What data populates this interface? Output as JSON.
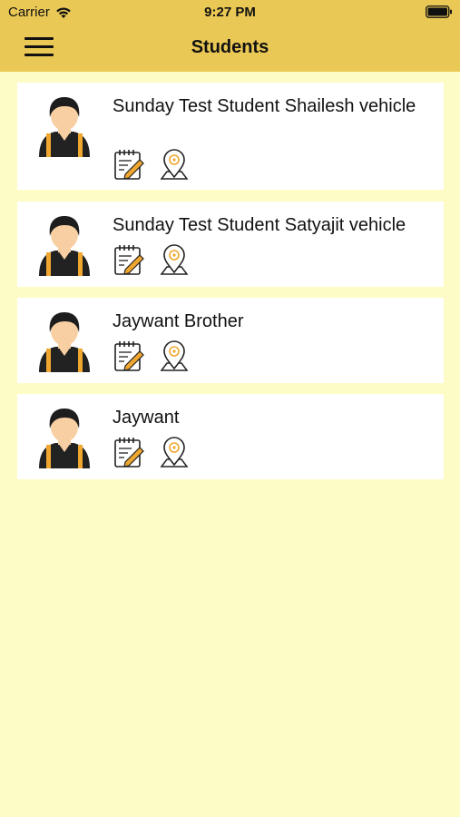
{
  "status_bar": {
    "carrier": "Carrier",
    "time": "9:27 PM"
  },
  "nav": {
    "title": "Students"
  },
  "colors": {
    "header": "#eac855",
    "background": "#fefcc6",
    "card": "#ffffff",
    "accent": "#f0a72f"
  },
  "students": [
    {
      "name": "Sunday Test Student Shailesh vehicle"
    },
    {
      "name": "Sunday Test Student Satyajit vehicle"
    },
    {
      "name": "Jaywant Brother"
    },
    {
      "name": "Jaywant"
    }
  ],
  "icons": {
    "menu": "hamburger-menu-icon",
    "edit": "notepad-pencil-icon",
    "location": "map-pin-icon",
    "avatar": "student-avatar-icon"
  }
}
